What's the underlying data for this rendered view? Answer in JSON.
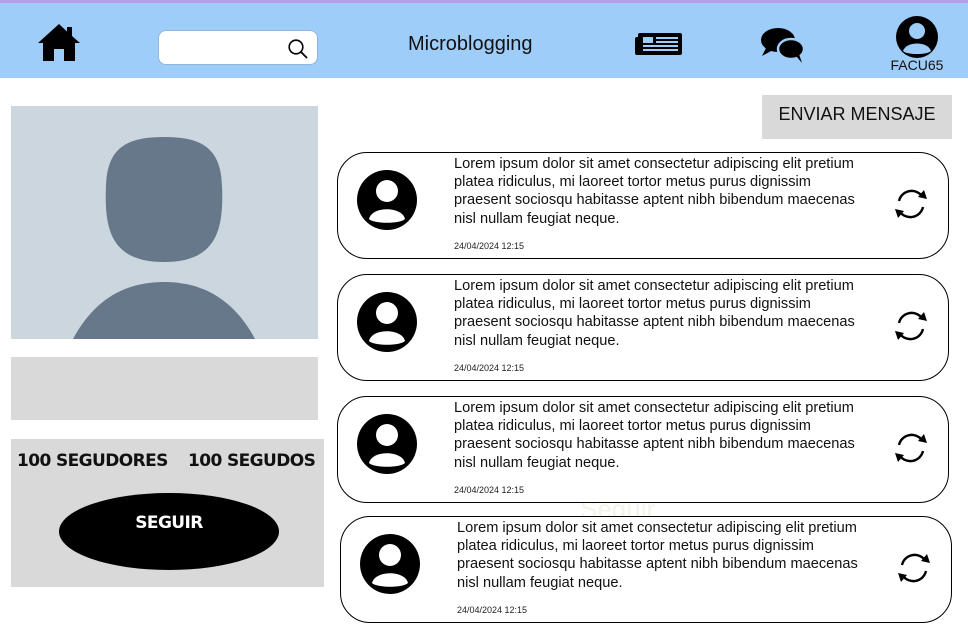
{
  "header": {
    "title": "Microblogging",
    "search": {
      "value": "",
      "placeholder": ""
    },
    "username": "FACU65",
    "icons": {
      "home": "home-icon",
      "search": "search-icon",
      "feed": "newspaper-icon",
      "chat": "chat-bubbles-icon",
      "user": "user-circle-icon"
    }
  },
  "profile": {
    "followers_label": "100 SEGUDORES",
    "following_label": "100 SEGUDOS",
    "follow_button": "SEGUIR",
    "bio": ""
  },
  "actions": {
    "send_message": "ENVIAR MENSAJE"
  },
  "posts": [
    {
      "text": "Lorem ipsum dolor sit amet consectetur adipiscing elit pretium platea ridiculus, mi laoreet tortor metus purus dignissim praesent sociosqu habitasse aptent nibh bibendum maecenas nisl nullam feugiat neque.",
      "date": "24/04/2024 12:15"
    },
    {
      "text": "Lorem ipsum dolor sit amet consectetur adipiscing elit pretium platea ridiculus, mi laoreet tortor metus purus dignissim praesent sociosqu habitasse aptent nibh bibendum maecenas nisl nullam feugiat neque.",
      "date": "24/04/2024 12:15"
    },
    {
      "text": "Lorem ipsum dolor sit amet consectetur adipiscing elit pretium platea ridiculus, mi laoreet tortor metus purus dignissim praesent sociosqu habitasse aptent nibh bibendum maecenas nisl nullam feugiat neque.",
      "date": "24/04/2024 12:15"
    },
    {
      "text": "Lorem ipsum dolor sit amet consectetur adipiscing elit pretium platea ridiculus, mi laoreet tortor metus purus dignissim praesent sociosqu habitasse aptent nibh bibendum maecenas nisl nullam feugiat neque.",
      "date": "24/04/2024 12:15"
    }
  ],
  "faded_text": "Seguir",
  "colors": {
    "header_bg": "#9fcdfa",
    "header_border": "#b89be6",
    "panel_gray": "#d9d9d9",
    "photo_bg": "#cbd6de",
    "silhouette": "#66788a"
  }
}
